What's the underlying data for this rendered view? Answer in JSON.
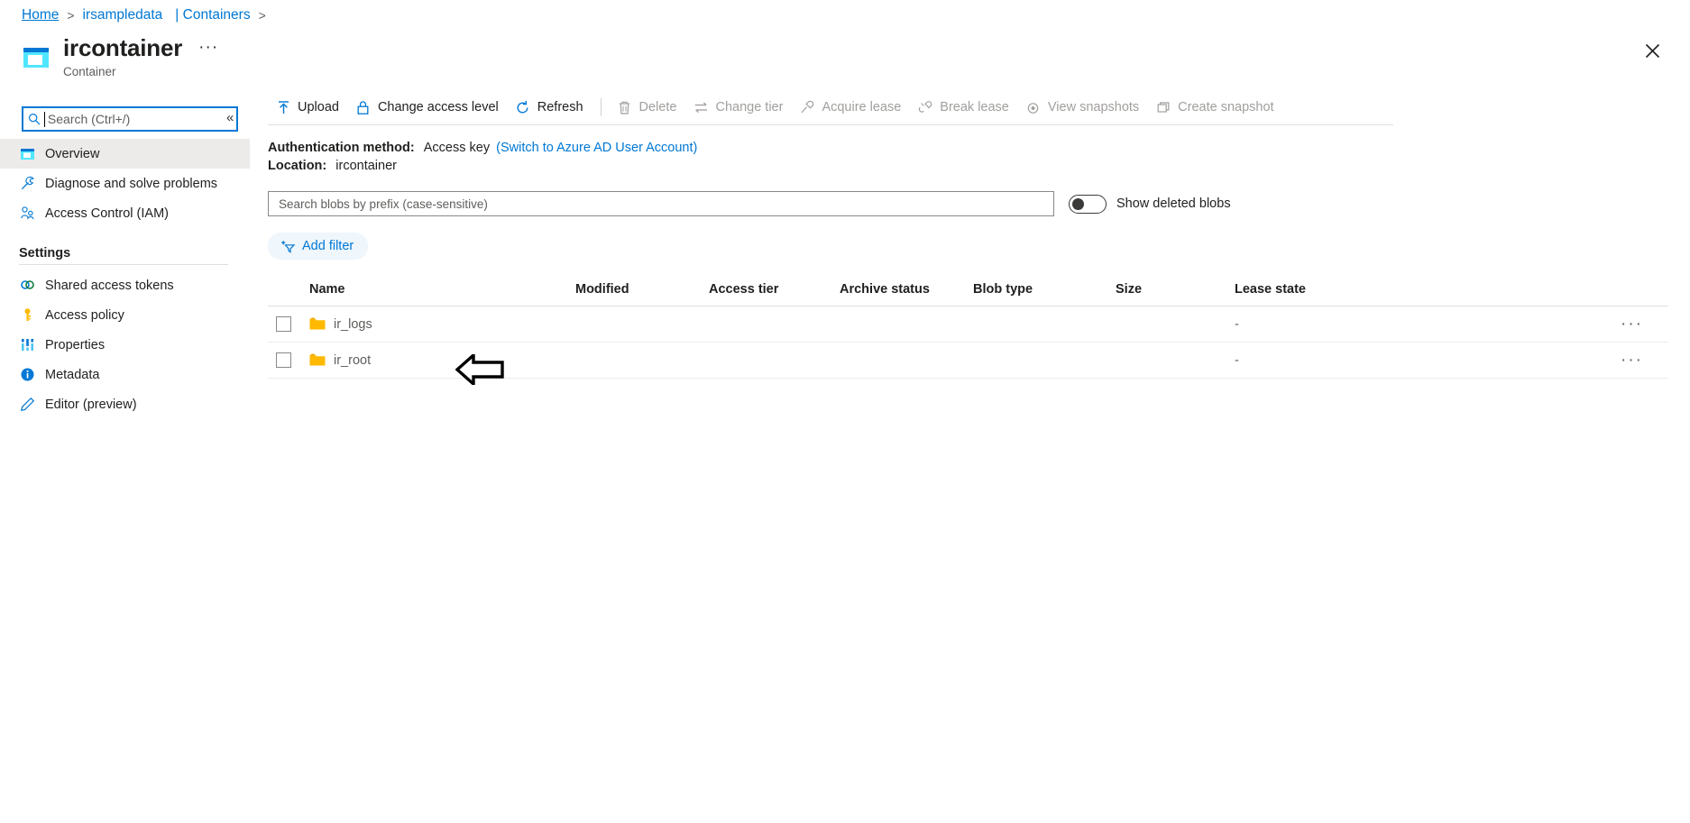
{
  "breadcrumb": {
    "home": "Home",
    "account": "irsampledata",
    "section": "| Containers"
  },
  "header": {
    "title": "ircontainer",
    "subtitle": "Container",
    "more_label": "···",
    "close_label": "✕"
  },
  "leftnav": {
    "search_placeholder": "Search (Ctrl+/)",
    "search_value": "",
    "collapse_label": "«",
    "items": [
      {
        "label": "Overview",
        "icon": "container-icon",
        "selected": true
      },
      {
        "label": "Diagnose and solve problems",
        "icon": "wrench-icon",
        "selected": false
      },
      {
        "label": "Access Control (IAM)",
        "icon": "people-icon",
        "selected": false
      }
    ],
    "settings_title": "Settings",
    "settings_items": [
      {
        "label": "Shared access tokens",
        "icon": "link-icon"
      },
      {
        "label": "Access policy",
        "icon": "key-icon"
      },
      {
        "label": "Properties",
        "icon": "bars-icon"
      },
      {
        "label": "Metadata",
        "icon": "info-icon"
      },
      {
        "label": "Editor (preview)",
        "icon": "pencil-icon"
      }
    ]
  },
  "toolbar": {
    "buttons": [
      {
        "label": "Upload",
        "icon": "upload-icon",
        "disabled": false
      },
      {
        "label": "Change access level",
        "icon": "lock-icon",
        "disabled": false
      },
      {
        "label": "Refresh",
        "icon": "refresh-icon",
        "disabled": false
      },
      {
        "label": "Delete",
        "icon": "trash-icon",
        "disabled": true
      },
      {
        "label": "Change tier",
        "icon": "swap-icon",
        "disabled": true
      },
      {
        "label": "Acquire lease",
        "icon": "plug-icon",
        "disabled": true
      },
      {
        "label": "Break lease",
        "icon": "unplug-icon",
        "disabled": true
      },
      {
        "label": "View snapshots",
        "icon": "camera-icon",
        "disabled": true
      },
      {
        "label": "Create snapshot",
        "icon": "copy-icon",
        "disabled": true
      }
    ]
  },
  "info": {
    "auth_label": "Authentication method:",
    "auth_value": "Access key",
    "auth_switch_link": "(Switch to Azure AD User Account)",
    "location_label": "Location:",
    "location_value": "ircontainer"
  },
  "filters": {
    "search_placeholder": "Search blobs by prefix (case-sensitive)",
    "search_value": "",
    "show_deleted_label": "Show deleted blobs",
    "show_deleted_on": false,
    "add_filter_label": "Add filter"
  },
  "table": {
    "columns": [
      "Name",
      "Modified",
      "Access tier",
      "Archive status",
      "Blob type",
      "Size",
      "Lease state"
    ],
    "rows": [
      {
        "name": "ir_logs",
        "icon": "folder-icon",
        "checked": false,
        "modified": "",
        "access_tier": "",
        "archive_status": "",
        "blob_type": "",
        "size": "",
        "lease_state": "-",
        "menu": "···"
      },
      {
        "name": "ir_root",
        "icon": "folder-icon",
        "checked": false,
        "modified": "",
        "access_tier": "",
        "archive_status": "",
        "blob_type": "",
        "size": "",
        "lease_state": "-",
        "menu": "···"
      }
    ]
  },
  "annotation": {
    "arrow": "left-pointing-arrow"
  },
  "colors": {
    "accent": "#0078d4",
    "folder": "#ffb900",
    "selected_bg": "#edebe9",
    "disabled_text": "#a19f9d"
  }
}
